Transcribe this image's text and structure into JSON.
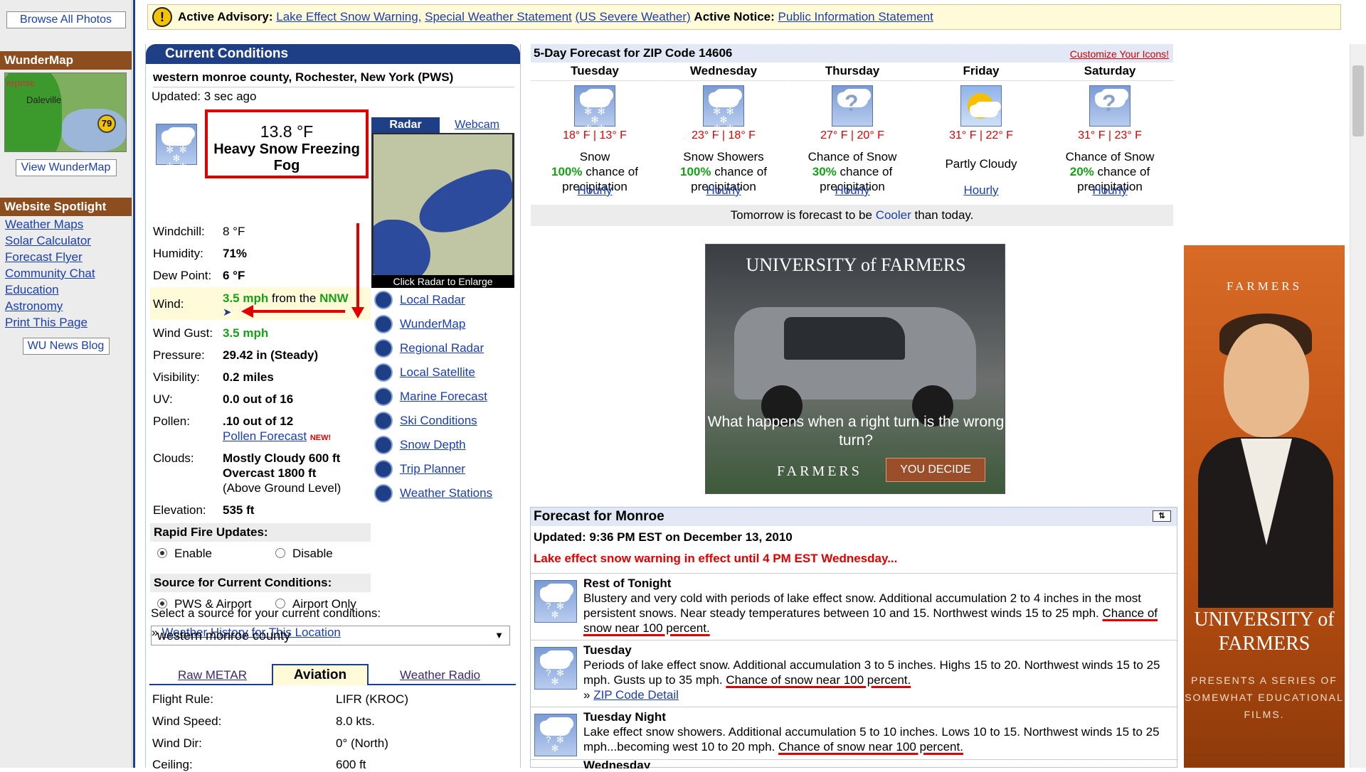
{
  "left": {
    "browse_photos": "Browse All Photos",
    "wundermap_title": "WunderMap",
    "map_labels": [
      "erprise",
      "Daleville",
      "79"
    ],
    "view_wundermap": "View WunderMap",
    "spotlight_title": "Website Spotlight",
    "spotlight_links": [
      "Weather Maps",
      "Solar Calculator",
      "Forecast Flyer",
      "Community Chat",
      "Education",
      "Astronomy",
      "Print This Page"
    ],
    "news_blog": "WU News Blog"
  },
  "advisory": {
    "prefix": "Active Advisory:",
    "link1": "Lake Effect Snow Warning,",
    "link2": "Special Weather Statement",
    "link3": "(US Severe Weather)",
    "notice_label": "Active Notice:",
    "notice_link": "Public Information Statement"
  },
  "current": {
    "title": "Current Conditions",
    "location": "western monroe county, Rochester, New York (PWS)",
    "updated": "Updated: 3 sec ago",
    "temperature": "13.8 °F",
    "condition": "Heavy Snow Freezing Fog",
    "rows": {
      "windchill": {
        "label": "Windchill:",
        "value": "8 °F"
      },
      "humidity": {
        "label": "Humidity:",
        "value": "71%"
      },
      "dewpoint": {
        "label": "Dew Point:",
        "value": "6 °F"
      },
      "wind": {
        "label": "Wind:",
        "speed": "3.5 mph",
        "from": "from the",
        "dir": "NNW"
      },
      "gust": {
        "label": "Wind Gust:",
        "value": "3.5 mph"
      },
      "pressure": {
        "label": "Pressure:",
        "value": "29.42 in (Steady)"
      },
      "visibility": {
        "label": "Visibility:",
        "value": "0.2 miles"
      },
      "uv": {
        "label": "UV:",
        "value": "0.0 out of 16"
      },
      "pollen": {
        "label": "Pollen:",
        "value": ".10 out of 12",
        "link": "Pollen Forecast",
        "new": "NEW!"
      },
      "clouds": {
        "label": "Clouds:",
        "line1": "Mostly Cloudy 600 ft",
        "line2": "Overcast 1800 ft",
        "line3": "(Above Ground Level)"
      },
      "elevation": {
        "label": "Elevation:",
        "value": "535 ft"
      }
    },
    "radar_tab": "Radar",
    "webcam_tab": "Webcam",
    "radar_caption": "Click Radar to Enlarge",
    "map_links": [
      "Local Radar",
      "WunderMap",
      "Regional Radar",
      "Local Satellite",
      "Marine Forecast",
      "Ski Conditions",
      "Snow Depth",
      "Trip Planner",
      "Weather Stations"
    ],
    "rapid_fire": "Rapid Fire Updates:",
    "enable": "Enable",
    "disable": "Disable",
    "source_title": "Source for Current Conditions:",
    "pws_airport": "PWS & Airport",
    "airport_only": "Airport Only",
    "history_prefix": "»",
    "history_link": "Weather History for This Location",
    "select_label": "Select a source for your current conditions:",
    "select_value": "western monroe county",
    "tabs": {
      "raw": "Raw METAR",
      "aviation": "Aviation",
      "radio": "Weather Radio"
    },
    "aviation": [
      {
        "label": "Flight Rule:",
        "value": "LIFR (KROC)"
      },
      {
        "label": "Wind Speed:",
        "value": "8.0 kts."
      },
      {
        "label": "Wind Dir:",
        "value": "0° (North)"
      },
      {
        "label": "Ceiling:",
        "value": "600 ft"
      }
    ]
  },
  "forecast5": {
    "title": "5-Day Forecast for ZIP Code 14606",
    "customize": "Customize Your Icons!",
    "days": [
      {
        "name": "Tuesday",
        "temps": "18° F | 13° F",
        "cond": "Snow",
        "pct": "100%",
        "pct_text": "chance of precipitation",
        "hourly": "Hourly",
        "icon": "snow-icon"
      },
      {
        "name": "Wednesday",
        "temps": "23° F | 18° F",
        "cond": "Snow Showers",
        "pct": "100%",
        "pct_text": "chance of precipitation",
        "hourly": "Hourly",
        "icon": "snow-icon"
      },
      {
        "name": "Thursday",
        "temps": "27° F | 20° F",
        "cond": "Chance of Snow",
        "pct": "30%",
        "pct_text": "chance of precipitation",
        "hourly": "Hourly",
        "icon": "chance-snow-icon"
      },
      {
        "name": "Friday",
        "temps": "31° F | 22° F",
        "cond": "Partly Cloudy",
        "pct": "",
        "pct_text": "",
        "hourly": "Hourly",
        "icon": "partly-cloudy-icon"
      },
      {
        "name": "Saturday",
        "temps": "31° F | 23° F",
        "cond": "Chance of Snow",
        "pct": "20%",
        "pct_text": "chance of precipitation",
        "hourly": "Hourly",
        "icon": "chance-snow-icon"
      }
    ],
    "tomorrow_pre": "Tomorrow is forecast to be",
    "tomorrow_word": "Cooler",
    "tomorrow_post": "than today."
  },
  "ads": {
    "ad1_brand": "UNIVERSITY of FARMERS",
    "ad1_question": "What happens when a right turn is the wrong turn?",
    "ad1_farmers": "FARMERS",
    "ad1_button": "YOU DECIDE",
    "ad2_farmers": "FARMERS",
    "ad2_univ": "UNIVERSITY of FARMERS",
    "ad2_presents": "PRESENTS A SERIES OF SOMEWHAT EDUCATIONAL FILMS."
  },
  "monroe": {
    "title": "Forecast for Monroe",
    "updated": "Updated: 9:36 PM EST on December 13, 2010",
    "warning": "Lake effect snow warning in effect until 4 PM EST Wednesday...",
    "periods": [
      {
        "name": "Rest of Tonight",
        "text": "Blustery and very cold with periods of lake effect snow. Additional accumulation 2 to 4 inches in the most persistent snows. Near steady temperatures between 10 and 15. Northwest winds 15 to 25 mph.",
        "chance": "Chance of snow near 100 percent."
      },
      {
        "name": "Tuesday",
        "text": "Periods of lake effect snow. Additional accumulation 3 to 5 inches. Highs 15 to 20. Northwest winds 15 to 25 mph. Gusts up to 35 mph.",
        "chance": "Chance of snow near 100 percent.",
        "zip_link": "ZIP Code Detail"
      },
      {
        "name": "Tuesday Night",
        "text": "Lake effect snow showers. Additional accumulation 5 to 10 inches. Lows 10 to 15. Northwest winds 15 to 25 mph...becoming west 10 to 20 mph.",
        "chance": "Chance of snow near 100 percent."
      },
      {
        "name": "Wednesday",
        "text": "",
        "chance": ""
      }
    ]
  }
}
